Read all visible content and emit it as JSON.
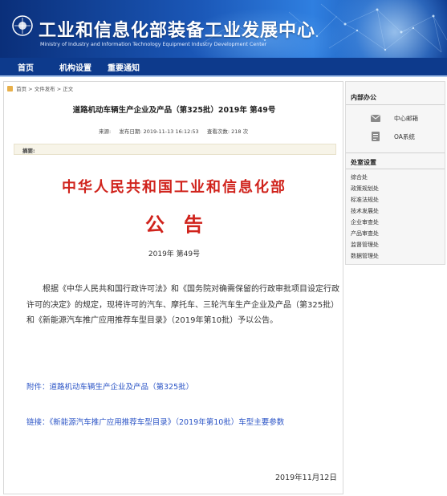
{
  "header": {
    "title": "工业和信息化部装备工业发展中心",
    "subtitle": "Ministry of Industry and Information Technology Equipment Industry Development Center"
  },
  "nav": {
    "items": [
      "首页",
      "机构设置",
      "重要通知"
    ]
  },
  "breadcrumb": {
    "home": "首页",
    "sep": ">",
    "level2": "文件发布",
    "level3": "正文"
  },
  "article": {
    "title": "道路机动车辆生产企业及产品（第325批）2019年 第49号",
    "source_label": "来源:",
    "date_label": "发布日期:",
    "date_value": "2019-11-13 16:12:53",
    "views_label": "查看次数:",
    "views_value": "218 次",
    "summary_label": "摘要:",
    "issuer": "中华人民共和国工业和信息化部",
    "notice_word": "公告",
    "doc_number": "2019年 第49号",
    "body": "根据《中华人民共和国行政许可法》和《国务院对确需保留的行政审批项目设定行政许可的决定》的规定，现将许可的汽车、摩托车、三轮汽车生产企业及产品（第325批）和《新能源汽车推广应用推荐车型目录》（2019年第10批）予以公告。",
    "attachment_label": "附件：",
    "attachment_link": "道路机动车辆生产企业及产品（第325批）",
    "link_label": "链接：",
    "link_text": "《新能源汽车推广应用推荐车型目录》（2019年第10批）车型主要参数",
    "sign_date": "2019年11月12日"
  },
  "sidebar": {
    "internal_title": "内部办公",
    "quick_links": [
      {
        "label": "中心邮箱",
        "icon": "mail-icon"
      },
      {
        "label": "OA系统",
        "icon": "oa-icon"
      }
    ],
    "dept_title": "处室设置",
    "departments": [
      "综合处",
      "政策规划处",
      "标准法规处",
      "技术发展处",
      "企业审查处",
      "产品审查处",
      "监督管理处",
      "数据管理处"
    ]
  },
  "colors": {
    "banner": "#1b58b8",
    "nav": "#0d3a8c",
    "heading_red": "#d0231c",
    "link_blue": "#2b54c6"
  }
}
